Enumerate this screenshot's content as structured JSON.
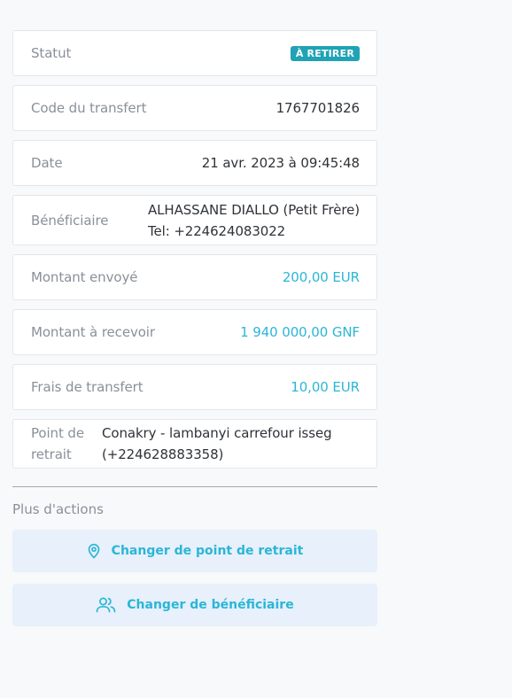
{
  "details": {
    "status": {
      "label": "Statut",
      "badge": "À RETIRER"
    },
    "code": {
      "label": "Code du transfert",
      "value": "1767701826"
    },
    "date": {
      "label": "Date",
      "value": "21 avr. 2023 à 09:45:48"
    },
    "beneficiary": {
      "label": "Bénéficiaire",
      "name": "ALHASSANE DIALLO (Petit Frère)",
      "phone": "Tel: +224624083022"
    },
    "amount_sent": {
      "label": "Montant envoyé",
      "value": "200,00 EUR"
    },
    "amount_received": {
      "label": "Montant à recevoir",
      "value": "1 940 000,00 GNF"
    },
    "fees": {
      "label": "Frais de transfert",
      "value": "10,00 EUR"
    },
    "pickup_point": {
      "label_line1": "Point de",
      "label_line2": "retrait",
      "line1": "Conakry - lambanyi carrefour isseg",
      "line2": "(+224628883358)"
    }
  },
  "actions": {
    "title": "Plus d'actions",
    "change_pickup": "Changer de point de retrait",
    "change_beneficiary": "Changer de bénéficiaire"
  },
  "colors": {
    "accent": "#2bb6d6",
    "badge": "#1fa3b5",
    "button_bg": "#e7f0fb"
  },
  "icons": {
    "pickup": "map-pin-icon",
    "beneficiary": "users-icon"
  }
}
